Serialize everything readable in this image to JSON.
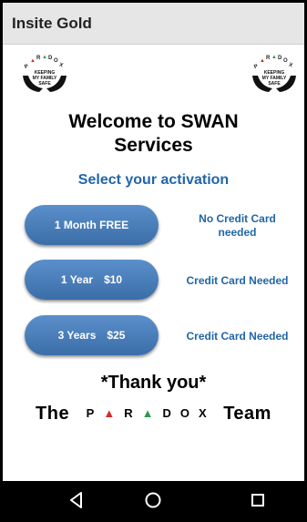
{
  "app": {
    "title": "Insite Gold"
  },
  "logo": {
    "brand_letters": "PARADOX",
    "tagline_line1": "KEEPING",
    "tagline_line2": "MY FAMILY",
    "tagline_line3": "SAFE"
  },
  "main": {
    "welcome_line1": "Welcome to SWAN",
    "welcome_line2": "Services",
    "select_heading": "Select your activation"
  },
  "plans": [
    {
      "button_label": "1 Month FREE",
      "button_label_a": "1 Month FREE",
      "button_label_b": "",
      "note_line1": "No Credit Card",
      "note_line2": "needed"
    },
    {
      "button_label_a": "1 Year",
      "button_label_b": "$10",
      "note_line1": "Credit Card Needed",
      "note_line2": ""
    },
    {
      "button_label_a": "3 Years",
      "button_label_b": "$25",
      "note_line1": "Credit Card Needed",
      "note_line2": ""
    }
  ],
  "footer": {
    "thanks": "*Thank you*",
    "team_prefix": "The",
    "team_suffix": "Team",
    "brand": {
      "p": "P",
      "a1": "▲",
      "r": "R",
      "a2": "▲",
      "d": "D",
      "o": "O",
      "x": "X"
    }
  },
  "colors": {
    "accent": "#2166a7",
    "button": "#4a7fbb",
    "triangle_red": "#d82a2a",
    "triangle_green": "#2e9a4b"
  },
  "navbar": {
    "back_icon": "back-triangle-icon",
    "home_icon": "home-circle-icon",
    "recent_icon": "recent-square-icon"
  }
}
